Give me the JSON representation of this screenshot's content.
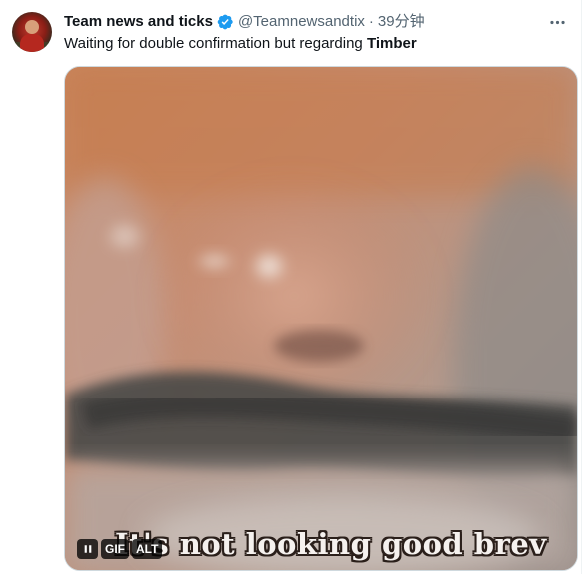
{
  "tweet": {
    "author": {
      "display_name": "Team news and ticks",
      "handle": "@Teamnewsandtix",
      "separator": "·",
      "time": "39分钟",
      "verified_color": "#1d9bf0"
    },
    "text_prefix": "Waiting for double confirmation but regarding ",
    "text_bold": "Timber",
    "media": {
      "caption": "It's not looking good brev",
      "controls": {
        "pause_icon": "pause-icon",
        "gif_label": "GIF",
        "alt_label": "ALT"
      }
    },
    "more_icon": "more-horizontal-icon"
  },
  "colors": {
    "text_primary": "#0f1419",
    "text_secondary": "#536471",
    "accent": "#1d9bf0",
    "border": "#cfd9de"
  }
}
